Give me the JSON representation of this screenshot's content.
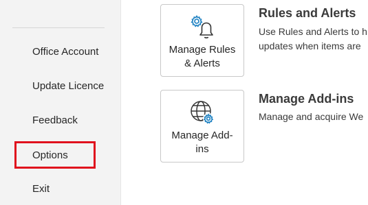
{
  "sidebar": {
    "items": [
      {
        "label": "Office Account"
      },
      {
        "label": "Update Licence"
      },
      {
        "label": "Feedback"
      },
      {
        "label": "Options",
        "highlighted": true
      },
      {
        "label": "Exit"
      }
    ],
    "highlight_color": "#e0101d"
  },
  "main": {
    "sections": [
      {
        "tile_label_line1": "Manage Rules",
        "tile_label_line2": "& Alerts",
        "tile_icon": "gear-bell-icon",
        "title": "Rules and Alerts",
        "desc_line1": "Use Rules and Alerts to h",
        "desc_line2": "updates when items are"
      },
      {
        "tile_label_line1": "Manage Add-",
        "tile_label_line2": "ins",
        "tile_icon": "globe-gear-icon",
        "title": "Manage Add-ins",
        "desc_line1": "Manage and acquire We"
      }
    ],
    "accent_color": "#1a7fc1"
  }
}
